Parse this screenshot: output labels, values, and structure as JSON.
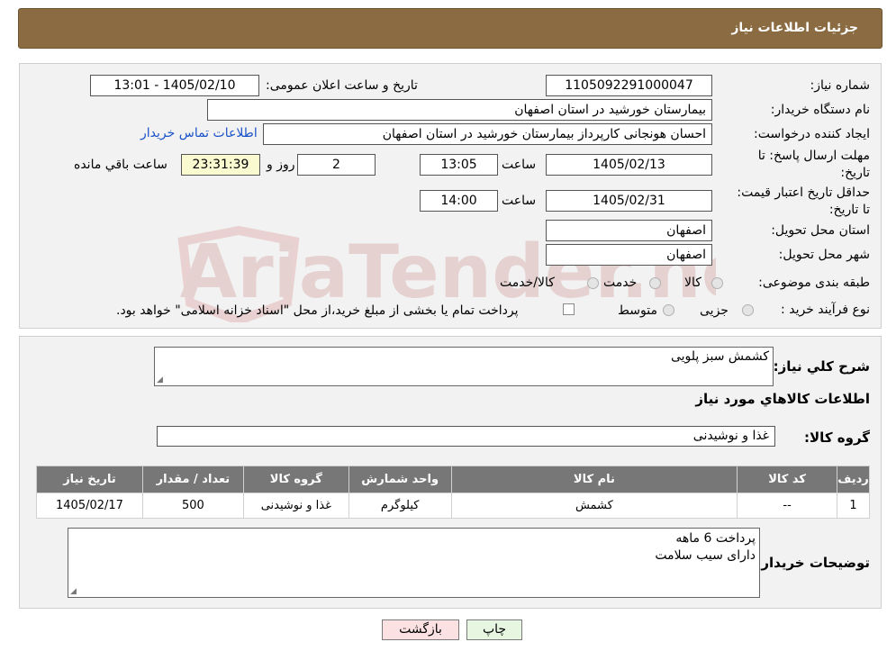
{
  "header": {
    "title": "جزئیات اطلاعات نیاز"
  },
  "form": {
    "need_number_label": "شماره نیاز:",
    "need_number": "1105092291000047",
    "announce_label": "تاریخ و ساعت اعلان عمومی:",
    "announce_value": "1405/02/10 - 13:01",
    "buyer_org_label": "نام دستگاه خریدار:",
    "buyer_org": "بیمارستان خورشید در استان اصفهان",
    "creator_label": "ایجاد کننده درخواست:",
    "creator": "احسان هونجانی کارپرداز بیمارستان خورشید در استان اصفهان",
    "contact_link": "اطلاعات تماس خریدار",
    "deadline_label": "مهلت ارسال پاسخ: تا تاریخ:",
    "deadline_date": "1405/02/13",
    "time_label": "ساعت",
    "deadline_time": "13:05",
    "days_value": "2",
    "days_label": "روز و",
    "remaining_time": "23:31:39",
    "remaining_label": "ساعت باقي مانده",
    "validity_label": "حداقل تاریخ اعتبار قیمت: تا تاریخ:",
    "validity_date": "1405/02/31",
    "validity_time": "14:00",
    "province_label": "استان محل تحویل:",
    "province": "اصفهان",
    "city_label": "شهر محل تحویل:",
    "city": "اصفهان",
    "category_label": "طبقه بندی موضوعی:",
    "category_options": [
      "کالا",
      "خدمت",
      "کالا/خدمت"
    ],
    "purchase_type_label": "نوع فرآیند خرید :",
    "purchase_type_options": [
      "جزیی",
      "متوسط"
    ],
    "payment_note": "پرداخت تمام یا بخشی از مبلغ خرید،از محل \"اسناد خزانه اسلامی\" خواهد بود."
  },
  "details": {
    "summary_label": "شرح کلي نياز:",
    "summary": "کشمش سبز پلویی",
    "items_heading": "اطلاعات کالاهاي مورد نياز",
    "group_label": "گروه کالا:",
    "group": "غذا و نوشیدنی",
    "table": {
      "headers": [
        "رديف",
        "کد کالا",
        "نام کالا",
        "واحد شمارش",
        "گروه کالا",
        "تعداد / مقدار",
        "تاریخ نیاز"
      ],
      "rows": [
        [
          "1",
          "--",
          "کشمش",
          "کیلوگرم",
          "غذا و نوشیدنی",
          "500",
          "1405/02/17"
        ]
      ]
    },
    "buyer_notes_label": "توضیحات خریدار:",
    "buyer_notes_line1": "پرداخت 6 ماهه",
    "buyer_notes_line2": "دارای سیب سلامت"
  },
  "buttons": {
    "print": "چاپ",
    "back": "بازگشت"
  },
  "watermark": {
    "text": "AriaTender.neT"
  },
  "colors": {
    "header": "#8b6c42",
    "table_header": "#777777",
    "link": "#1a52c8"
  }
}
